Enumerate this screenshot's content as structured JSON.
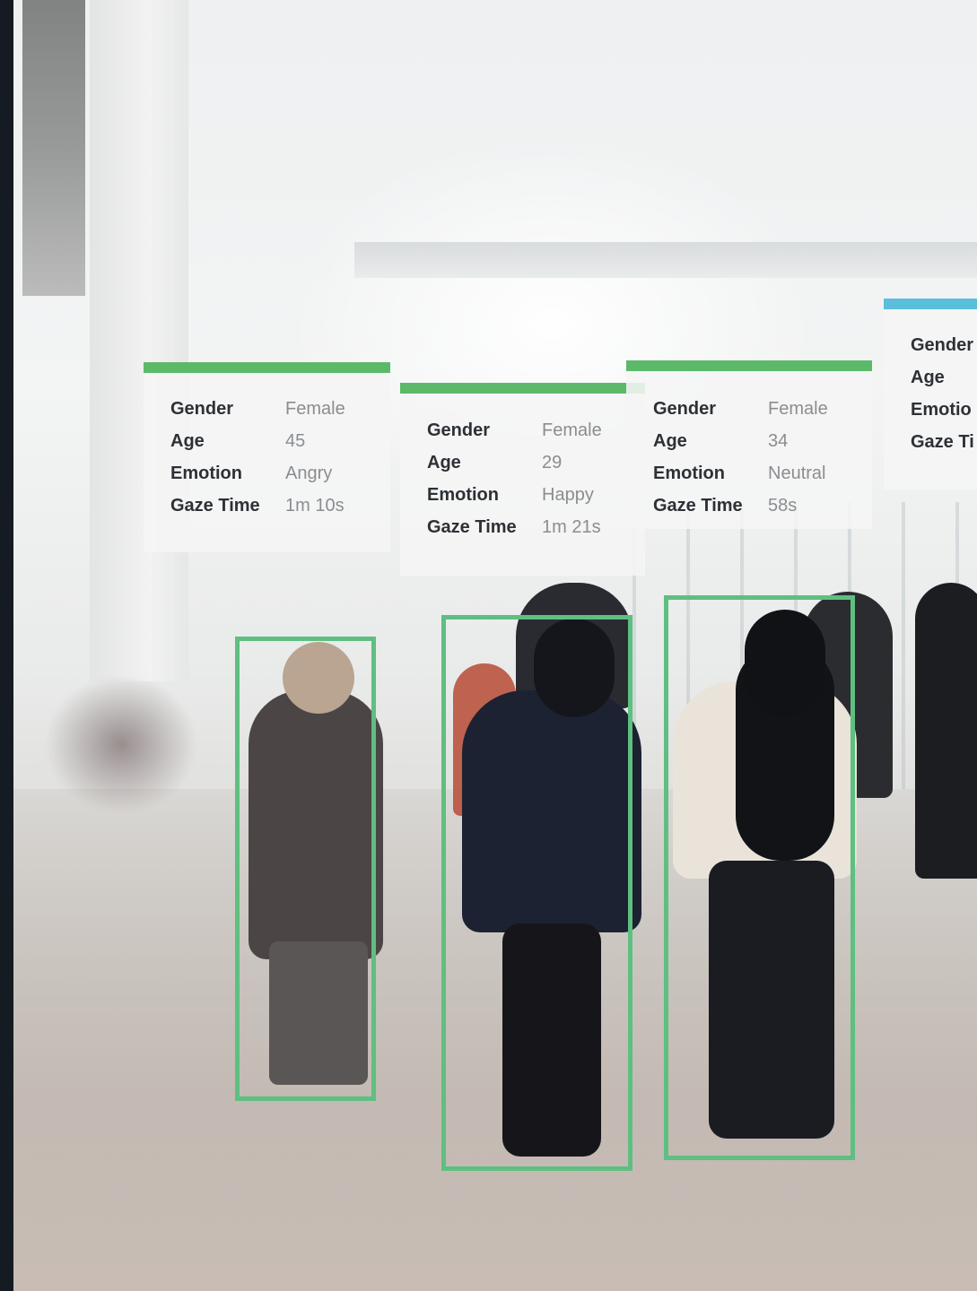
{
  "colors": {
    "box_green": "#5fbf80",
    "bar_green": "#5cb96a",
    "bar_blue": "#5bbfdc",
    "label_text": "#2d3136",
    "value_text": "#8a8d90"
  },
  "cards": [
    {
      "rows": [
        {
          "label": "Gender",
          "value": "Female"
        },
        {
          "label": "Age",
          "value": "45"
        },
        {
          "label": "Emotion",
          "value": "Angry"
        },
        {
          "label": "Gaze Time",
          "value": "1m 10s"
        }
      ]
    },
    {
      "rows": [
        {
          "label": "Gender",
          "value": "Female"
        },
        {
          "label": "Age",
          "value": "29"
        },
        {
          "label": "Emotion",
          "value": "Happy"
        },
        {
          "label": "Gaze Time",
          "value": "1m 21s"
        }
      ]
    },
    {
      "rows": [
        {
          "label": "Gender",
          "value": "Female"
        },
        {
          "label": "Age",
          "value": "34"
        },
        {
          "label": "Emotion",
          "value": "Neutral"
        },
        {
          "label": "Gaze Time",
          "value": "58s"
        }
      ]
    },
    {
      "rows": [
        {
          "label": "Gender",
          "value": ""
        },
        {
          "label": "Age",
          "value": ""
        },
        {
          "label": "Emotio",
          "value": ""
        },
        {
          "label": "Gaze Ti",
          "value": ""
        }
      ]
    }
  ]
}
